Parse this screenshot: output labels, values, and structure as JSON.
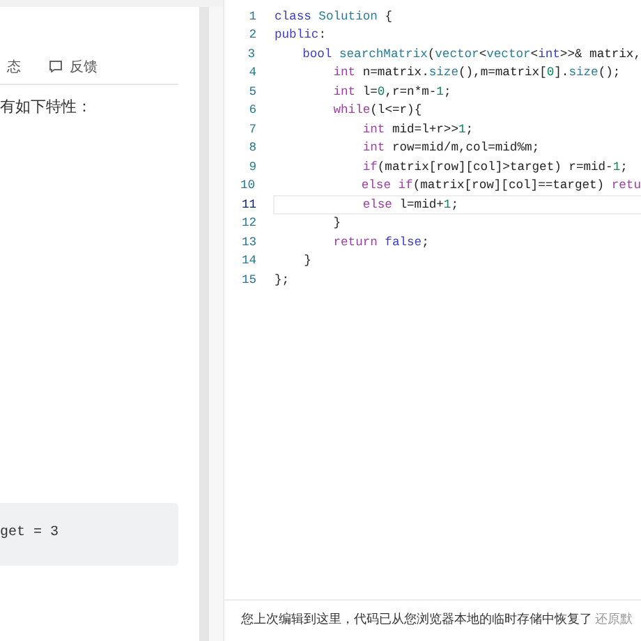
{
  "left_panel": {
    "tabs": [
      {
        "label": "态",
        "icon": false
      },
      {
        "label": "反馈",
        "icon": true
      }
    ],
    "description": "有如下特性：",
    "example_code": "get = 3"
  },
  "editor": {
    "lines": [
      {
        "n": "1",
        "current": false,
        "tokens": [
          {
            "t": "class",
            "color": "#3b3bd0"
          },
          {
            "t": " Solution",
            "color": "#267f99"
          },
          {
            "t": " {"
          }
        ]
      },
      {
        "n": "2",
        "current": false,
        "tokens": [
          {
            "t": "public",
            "color": "#3b3bd0"
          },
          {
            "t": ":"
          }
        ]
      },
      {
        "n": "3",
        "current": false,
        "tokens": [
          {
            "t": "    bool",
            "color": "#3b3bd0"
          },
          {
            "t": " searchMatrix",
            "color": "#267f99"
          },
          {
            "t": "("
          },
          {
            "t": "vector",
            "color": "#267f99"
          },
          {
            "t": "<"
          },
          {
            "t": "vector",
            "color": "#267f99"
          },
          {
            "t": "<"
          },
          {
            "t": "int",
            "color": "#3b3bd0"
          },
          {
            "t": ">>& matrix,"
          }
        ]
      },
      {
        "n": "4",
        "current": false,
        "tokens": [
          {
            "t": "        int",
            "color": "#a03ca8"
          },
          {
            "t": " n=matrix."
          },
          {
            "t": "size",
            "color": "#267f99"
          },
          {
            "t": "(),m=matrix["
          },
          {
            "t": "0",
            "color": "#098658"
          },
          {
            "t": "]."
          },
          {
            "t": "size",
            "color": "#267f99"
          },
          {
            "t": "();"
          }
        ]
      },
      {
        "n": "5",
        "current": false,
        "tokens": [
          {
            "t": "        int",
            "color": "#a03ca8"
          },
          {
            "t": " l="
          },
          {
            "t": "0",
            "color": "#098658"
          },
          {
            "t": ",r=n*m-"
          },
          {
            "t": "1",
            "color": "#098658"
          },
          {
            "t": ";"
          }
        ]
      },
      {
        "n": "6",
        "current": false,
        "tokens": [
          {
            "t": "        while",
            "color": "#a03ca8"
          },
          {
            "t": "(l<=r){"
          }
        ]
      },
      {
        "n": "7",
        "current": false,
        "tokens": [
          {
            "t": "            int",
            "color": "#a03ca8"
          },
          {
            "t": " mid=l+r>>"
          },
          {
            "t": "1",
            "color": "#098658"
          },
          {
            "t": ";"
          }
        ]
      },
      {
        "n": "8",
        "current": false,
        "tokens": [
          {
            "t": "            int",
            "color": "#a03ca8"
          },
          {
            "t": " row=mid/m,col=mid%m;"
          }
        ]
      },
      {
        "n": "9",
        "current": false,
        "tokens": [
          {
            "t": "            if",
            "color": "#a03ca8"
          },
          {
            "t": "(matrix[row][col]>target) r=mid-"
          },
          {
            "t": "1",
            "color": "#098658"
          },
          {
            "t": ";"
          }
        ]
      },
      {
        "n": "10",
        "current": false,
        "tokens": [
          {
            "t": "            else if",
            "color": "#a03ca8"
          },
          {
            "t": "(matrix[row][col]==target) "
          },
          {
            "t": "retu",
            "color": "#a03ca8"
          }
        ]
      },
      {
        "n": "11",
        "current": true,
        "tokens": [
          {
            "t": "            else",
            "color": "#a03ca8"
          },
          {
            "t": " l=mid+"
          },
          {
            "t": "1",
            "color": "#098658"
          },
          {
            "t": ";"
          }
        ]
      },
      {
        "n": "12",
        "current": false,
        "tokens": [
          {
            "t": "        }"
          }
        ]
      },
      {
        "n": "13",
        "current": false,
        "tokens": [
          {
            "t": "        return",
            "color": "#a03ca8"
          },
          {
            "t": " false",
            "color": "#3b3bd0"
          },
          {
            "t": ";"
          }
        ]
      },
      {
        "n": "14",
        "current": false,
        "tokens": [
          {
            "t": "    }"
          }
        ]
      },
      {
        "n": "15",
        "current": false,
        "tokens": [
          {
            "t": "};"
          }
        ]
      }
    ]
  },
  "status_bar": {
    "message": "您上次编辑到这里，代码已从您浏览器本地的临时存储中恢复了",
    "link": "还原默"
  }
}
